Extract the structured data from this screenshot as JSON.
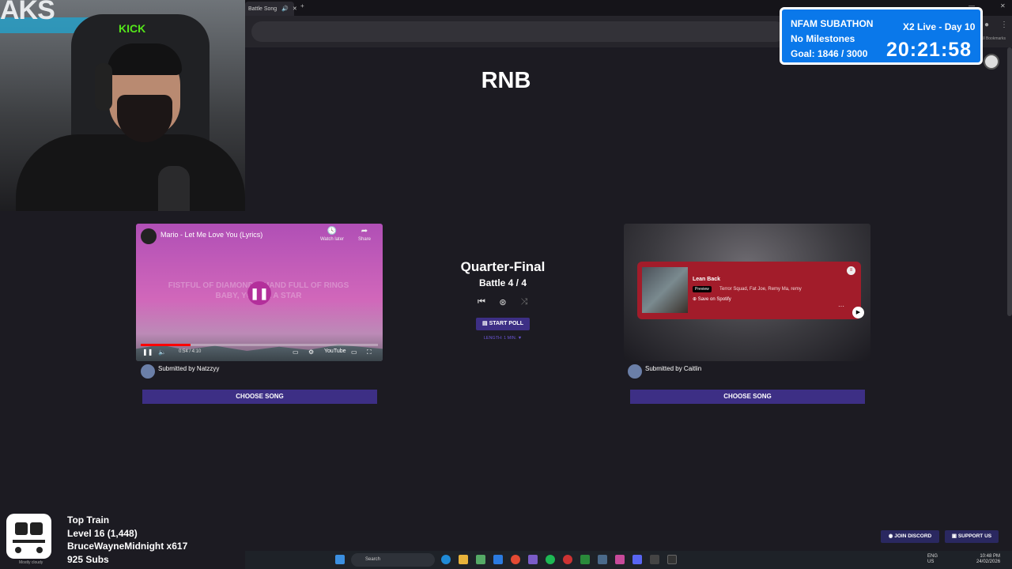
{
  "browser": {
    "tab_label": "Battle Song",
    "bookmarks_label": "All Bookmarks"
  },
  "subathon": {
    "title": "NFAM SUBATHON",
    "live_day": "X2 Live - Day 10",
    "milestones": "No Milestones",
    "goal": "Goal: 1846 / 3000",
    "timer": "20:21:58"
  },
  "category": "RNB",
  "left_song": {
    "title": "Mario - Let Me Love You (Lyrics)",
    "watch_later": "Watch later",
    "share": "Share",
    "lyrics_line1": "FISTFUL OF DIAMONDS, HAND FULL OF RINGS",
    "lyrics_line2": "BABY, YOU'RE A STAR",
    "time": "0:54 / 4:10",
    "progress": 0.21,
    "submitted_by": "Submitted by Natzzyy",
    "choose_label": "CHOOSE SONG"
  },
  "right_song": {
    "track": "Lean Back",
    "preview": "Preview",
    "artists": "Terror Squad, Fat Joe, Remy Ma, remy",
    "save": "Save on Spotify",
    "submitted_by": "Submitted by Caitlin",
    "choose_label": "CHOOSE SONG"
  },
  "battle": {
    "stage": "Quarter-Final",
    "count": "Battle 4 / 4",
    "start_poll": "START POLL",
    "length": "LENGTH: 1 MIN. ▼"
  },
  "top_train": {
    "title": "Top Train",
    "level": "Level 16  (1,448)",
    "user": "BruceWayneMidnight x617",
    "subs": "925 Subs",
    "weather": "Mostly cloudy"
  },
  "buttons": {
    "join_discord": "JOIN DISCORD",
    "support_us": "SUPPORT US"
  },
  "taskbar": {
    "search_placeholder": "Search",
    "lang": "ENG",
    "region": "US",
    "time": "10:48 PM",
    "date": "24/02/2026"
  },
  "colors": {
    "accent_purple": "#3d2f85",
    "spotify_card": "#a21c2a",
    "subathon_blue": "#0a78ea"
  }
}
